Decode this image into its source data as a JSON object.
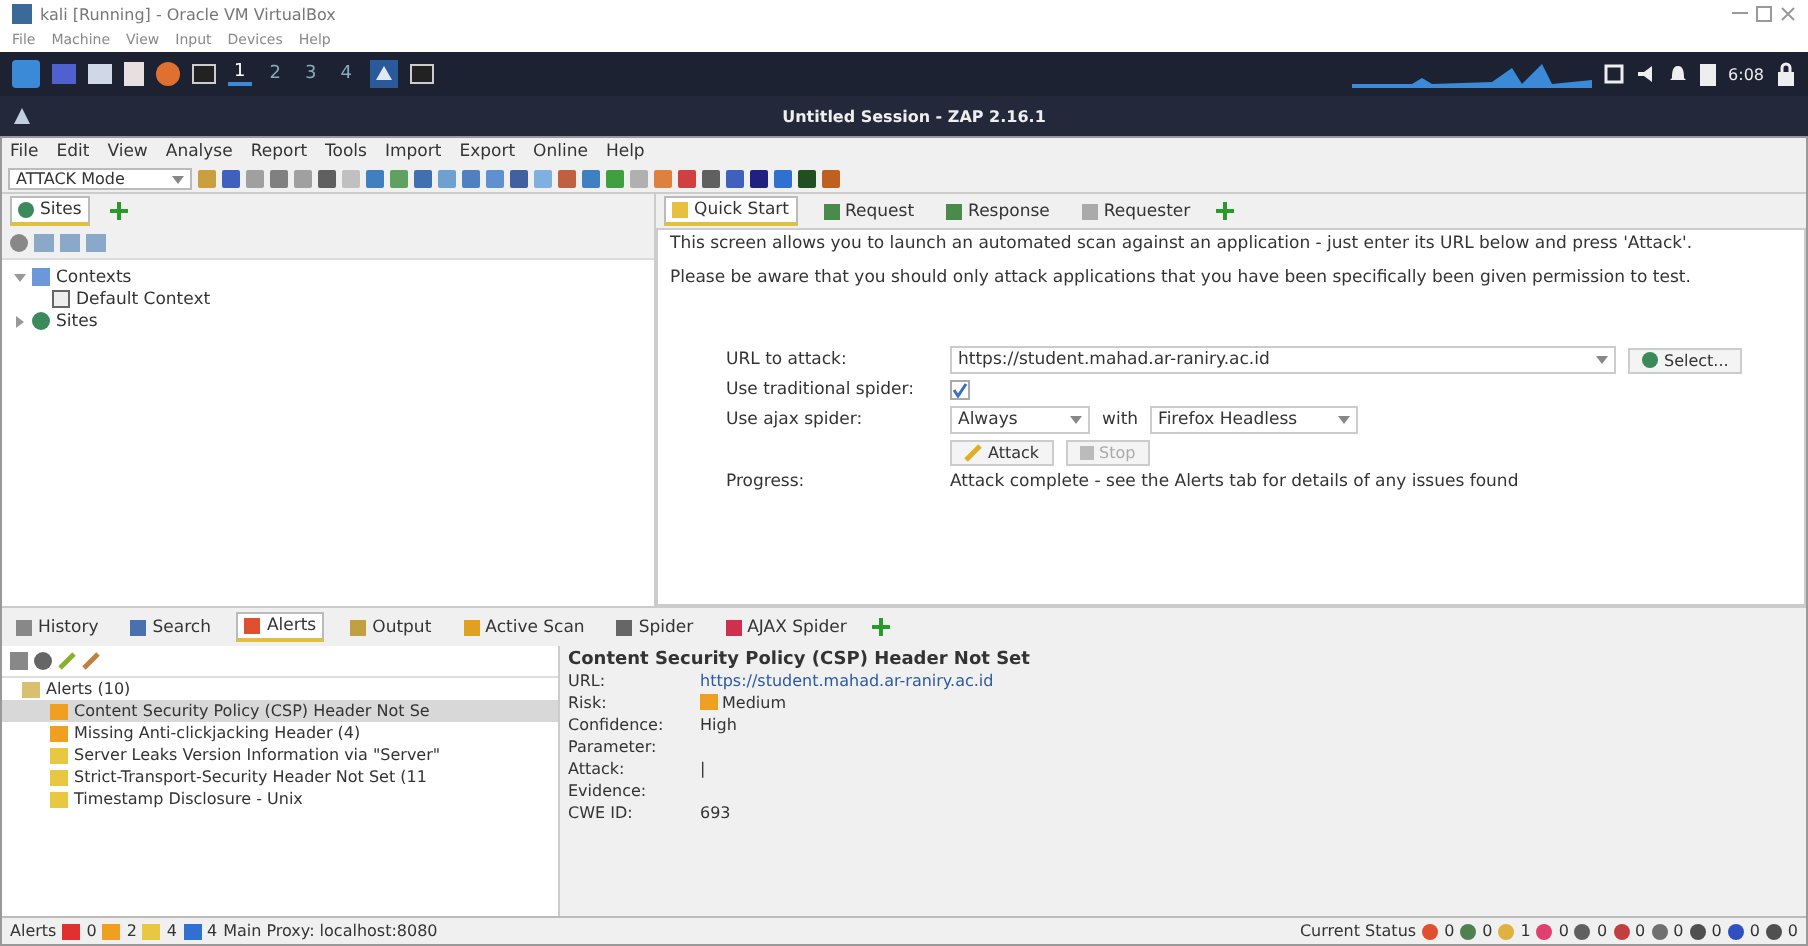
{
  "host_window": {
    "title": "kali [Running] - Oracle VM VirtualBox",
    "menu": [
      "File",
      "Machine",
      "View",
      "Input",
      "Devices",
      "Help"
    ]
  },
  "desktop_panel": {
    "workspaces": [
      {
        "label": "1",
        "selected": true
      },
      {
        "label": "2",
        "selected": false
      },
      {
        "label": "3",
        "selected": false
      },
      {
        "label": "4",
        "selected": false
      }
    ],
    "clock": "6:08"
  },
  "app_window": {
    "title": "Untitled Session - ZAP 2.16.1"
  },
  "menu": [
    "File",
    "Edit",
    "View",
    "Analyse",
    "Report",
    "Tools",
    "Import",
    "Export",
    "Online",
    "Help"
  ],
  "toolbar": {
    "mode": "ATTACK Mode"
  },
  "sites_panel": {
    "tab": "Sites",
    "tree": [
      {
        "label": "Contexts",
        "expanded": true,
        "children": [
          {
            "label": "Default Context"
          }
        ]
      },
      {
        "label": "Sites",
        "expanded": false
      }
    ]
  },
  "workspace_tabs": [
    {
      "label": "Quick Start",
      "selected": true
    },
    {
      "label": "Request",
      "selected": false
    },
    {
      "label": "Response",
      "selected": false
    },
    {
      "label": "Requester",
      "selected": false
    }
  ],
  "quick_start": {
    "intro": "This screen allows you to launch an automated scan against  an application - just enter its URL below and press 'Attack'.",
    "warning": "Please be aware that you should only attack applications that you have been specifically been given permission to test.",
    "url_label": "URL to attack:",
    "url_value": "https://student.mahad.ar-raniry.ac.id",
    "select_button": "Select...",
    "traditional_label": "Use traditional spider:",
    "traditional_checked": true,
    "ajax_label": "Use ajax spider:",
    "ajax_mode": "Always",
    "with_label": "with",
    "browser": "Firefox Headless",
    "attack_button": "Attack",
    "stop_button": "Stop",
    "stop_disabled": true,
    "progress_label": "Progress:",
    "progress_text": "Attack complete - see the Alerts tab for details of any issues found"
  },
  "bottom_tabs": [
    {
      "label": "History",
      "selected": false
    },
    {
      "label": "Search",
      "selected": false
    },
    {
      "label": "Alerts",
      "selected": true
    },
    {
      "label": "Output",
      "selected": false
    },
    {
      "label": "Active Scan",
      "selected": false
    },
    {
      "label": "Spider",
      "selected": false
    },
    {
      "label": "AJAX Spider",
      "selected": false
    }
  ],
  "alerts_tree": {
    "root": "Alerts (10)",
    "items": [
      {
        "label": "Content Security Policy (CSP) Header Not Se",
        "color": "#f0a020",
        "selected": true
      },
      {
        "label": "Missing Anti-clickjacking Header (4)",
        "color": "#f0a020",
        "selected": false
      },
      {
        "label": "Server Leaks Version Information via \"Server\"",
        "color": "#e8c840",
        "selected": false
      },
      {
        "label": "Strict-Transport-Security Header Not Set (11",
        "color": "#e8c840",
        "selected": false
      },
      {
        "label": "Timestamp Disclosure - Unix",
        "color": "#e8c840",
        "selected": false
      }
    ]
  },
  "alert_detail": {
    "title": "Content Security Policy (CSP) Header Not Set",
    "fields": [
      {
        "label": "URL:",
        "value": "https://student.mahad.ar-raniry.ac.id",
        "kind": "link"
      },
      {
        "label": "Risk:",
        "value": "Medium",
        "kind": "risk"
      },
      {
        "label": "Confidence:",
        "value": "High",
        "kind": "text"
      },
      {
        "label": "Parameter:",
        "kind": "text"
      },
      {
        "label": "Attack:",
        "value": "|",
        "kind": "text"
      },
      {
        "label": "Evidence:",
        "kind": "text"
      },
      {
        "label": "CWE ID:",
        "value": "693",
        "kind": "text"
      }
    ]
  },
  "status_bar": {
    "alerts_label": "Alerts",
    "alert_counts": [
      {
        "count": "0",
        "color": "#e03030"
      },
      {
        "count": "2",
        "color": "#f0a020"
      },
      {
        "count": "4",
        "color": "#e8c840"
      },
      {
        "count": "4",
        "color": "#3070d0"
      }
    ],
    "proxy": "Main Proxy: localhost:8080",
    "status_label": "Current Status",
    "status_counts": [
      {
        "count": "0",
        "color": "#e05030"
      },
      {
        "count": "0",
        "color": "#508050"
      },
      {
        "count": "1",
        "color": "#e0b040"
      },
      {
        "count": "0",
        "color": "#e04070"
      },
      {
        "count": "0",
        "color": "#606060"
      },
      {
        "count": "0",
        "color": "#c04040"
      },
      {
        "count": "0",
        "color": "#707070"
      },
      {
        "count": "0",
        "color": "#505050"
      },
      {
        "count": "0",
        "color": "#3050c0"
      },
      {
        "count": "0",
        "color": "#505050"
      }
    ]
  }
}
